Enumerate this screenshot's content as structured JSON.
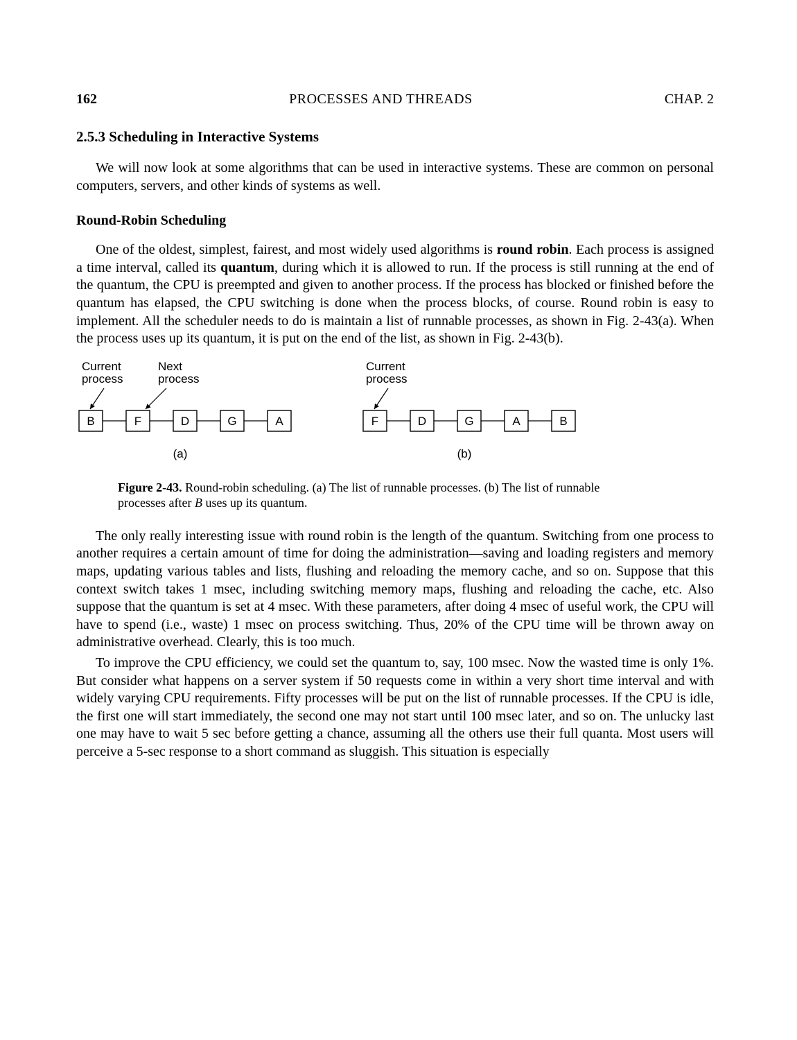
{
  "header": {
    "page_number": "162",
    "chapter_title": "PROCESSES AND THREADS",
    "chapter_label": "CHAP. 2"
  },
  "section": {
    "number": "2.5.3",
    "title": "Scheduling in Interactive Systems"
  },
  "paragraphs": {
    "intro": "We will now look at some algorithms that can be used in interactive systems. These are common on personal computers, servers, and other kinds of systems as well.",
    "sub1_heading": "Round-Robin Scheduling",
    "rr1_a": "One of the oldest, simplest, fairest, and most widely used algorithms is ",
    "rr1_b": "round robin",
    "rr1_c": ". Each process is assigned a time interval, called its ",
    "rr1_d": "quantum",
    "rr1_e": ", during which it is allowed to run. If the process is still running at the end of the quantum, the CPU is preempted and given to another process. If the process has blocked or finished before the quantum has elapsed, the CPU switching is done when the process blocks, of course. Round robin is easy to implement. All the scheduler needs to do is maintain a list of runnable processes, as shown in Fig. 2-43(a). When the process uses up its quantum, it is put on the end of the list, as shown in Fig. 2-43(b).",
    "rr2": "The only really interesting issue with round robin is the length of the quantum. Switching from one process to another requires a certain amount of time for doing the administration—saving and loading registers and memory maps, updating various tables and lists, flushing and reloading the memory cache, and so on. Suppose that this context switch takes 1 msec, including switching memory maps, flushing and reloading the cache, etc. Also suppose that the quantum is set at 4 msec. With these parameters, after doing 4 msec of useful work, the CPU will have to spend (i.e., waste) 1 msec on process switching. Thus, 20% of the CPU time will be thrown away on administrative overhead. Clearly, this is too much.",
    "rr3": "To improve the CPU efficiency, we could set the quantum to, say, 100 msec. Now the wasted time is only 1%. But consider what happens on a server system if 50 requests come in within a very short time interval and with widely varying CPU requirements. Fifty processes will be put on the list of runnable processes. If the CPU is idle, the first one will start immediately, the second one may not start until 100 msec later, and so on. The unlucky last one may have to wait 5 sec before getting a chance, assuming all the others use their full quanta. Most users will perceive a 5-sec response to a short command as sluggish. This situation is especially"
  },
  "figure": {
    "labels": {
      "current_process": "Current\nprocess",
      "next_process": "Next\nprocess",
      "a": "(a)",
      "b": "(b)"
    },
    "seq_a": [
      "B",
      "F",
      "D",
      "G",
      "A"
    ],
    "seq_b": [
      "F",
      "D",
      "G",
      "A",
      "B"
    ],
    "caption_lead": "Figure 2-43.",
    "caption_rest_a": " Round-robin scheduling. (a) The list of runnable processes. (b) The list of runnable processes after ",
    "caption_rest_b": "B",
    "caption_rest_c": " uses up its quantum."
  }
}
